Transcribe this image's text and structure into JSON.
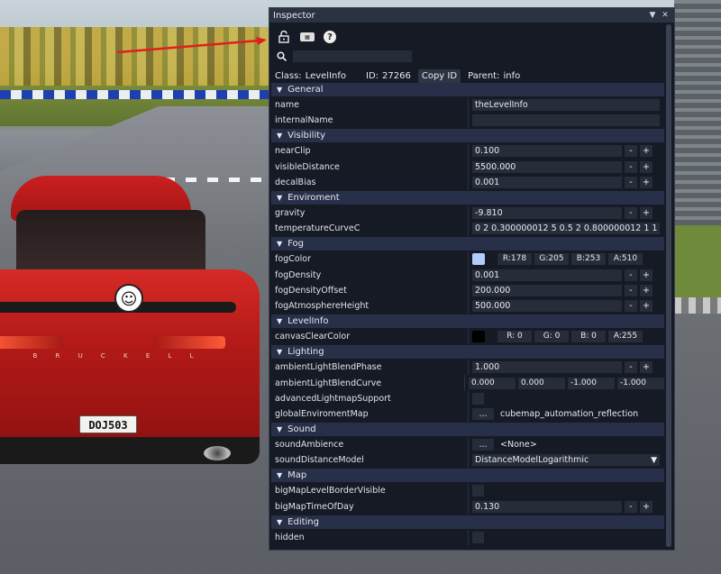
{
  "scene": {
    "plate": "DOJ503",
    "brand": "B R U C K E L L"
  },
  "inspector": {
    "title": "Inspector",
    "class_label": "Class:",
    "class_value": "LevelInfo",
    "id_label": "ID:",
    "id_value": "27266",
    "copy_id": "Copy ID",
    "parent_label": "Parent:",
    "parent_value": "info",
    "search_placeholder": ""
  },
  "cats": {
    "general": "General",
    "visibility": "Visibility",
    "enviroment": "Enviroment",
    "fog": "Fog",
    "levelinfo": "LevelInfo",
    "lighting": "Lighting",
    "sound": "Sound",
    "map": "Map",
    "editing": "Editing"
  },
  "props": {
    "name": {
      "label": "name",
      "value": "theLevelInfo"
    },
    "internalName": {
      "label": "internalName",
      "value": ""
    },
    "nearClip": {
      "label": "nearClip",
      "value": "0.100"
    },
    "visibleDistance": {
      "label": "visibleDistance",
      "value": "5500.000"
    },
    "decalBias": {
      "label": "decalBias",
      "value": "0.001"
    },
    "gravity": {
      "label": "gravity",
      "value": "-9.810"
    },
    "temperatureCurveC": {
      "label": "temperatureCurveC",
      "value": "0 2 0.300000012 5 0.5 2 0.800000012 1 1 2"
    },
    "fogColor": {
      "label": "fogColor",
      "swatch": "#b2cdfd",
      "r": "R:178",
      "g": "G:205",
      "b": "B:253",
      "a": "A:510"
    },
    "fogDensity": {
      "label": "fogDensity",
      "value": "0.001"
    },
    "fogDensityOffset": {
      "label": "fogDensityOffset",
      "value": "200.000"
    },
    "fogAtmosphereHeight": {
      "label": "fogAtmosphereHeight",
      "value": "500.000"
    },
    "canvasClearColor": {
      "label": "canvasClearColor",
      "swatch": "#000000",
      "r": "R:  0",
      "g": "G:  0",
      "b": "B:  0",
      "a": "A:255"
    },
    "ambientLightBlendPhase": {
      "label": "ambientLightBlendPhase",
      "value": "1.000"
    },
    "ambientLightBlendCurve": {
      "label": "ambientLightBlendCurve",
      "v1": "0.000",
      "v2": "0.000",
      "v3": "-1.000",
      "v4": "-1.000"
    },
    "advancedLightmapSupport": {
      "label": "advancedLightmapSupport"
    },
    "globalEnviromentMap": {
      "label": "globalEnviromentMap",
      "button": "...",
      "value": "cubemap_automation_reflection"
    },
    "soundAmbience": {
      "label": "soundAmbience",
      "button": "...",
      "value": "<None>"
    },
    "soundDistanceModel": {
      "label": "soundDistanceModel",
      "value": "DistanceModelLogarithmic"
    },
    "bigMapLevelBorderVisible": {
      "label": "bigMapLevelBorderVisible"
    },
    "bigMapTimeOfDay": {
      "label": "bigMapTimeOfDay",
      "value": "0.130"
    },
    "hidden": {
      "label": "hidden"
    }
  },
  "buttons": {
    "minus": "-",
    "plus": "+"
  },
  "colors": {
    "accent_arrow": "#e0201c",
    "panel_bg": "#161a24",
    "category_bg": "#283049",
    "field_bg": "#262c3a"
  }
}
